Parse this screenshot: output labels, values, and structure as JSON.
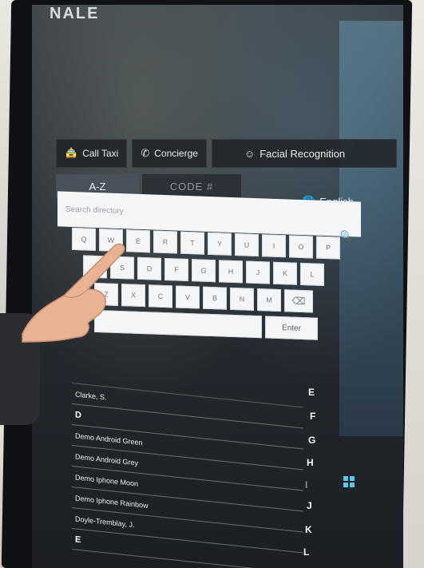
{
  "screen": {
    "brand": "NALE"
  },
  "actions": [
    {
      "label": "Call Taxi",
      "icon": "taxi-icon"
    },
    {
      "label": "Concierge",
      "icon": "phone-icon"
    },
    {
      "label": "Facial Recognition",
      "icon": "face-icon"
    }
  ],
  "tabs": [
    {
      "label": "A-Z",
      "active": true
    },
    {
      "label": "CODE #",
      "active": false
    }
  ],
  "language": {
    "label": "English",
    "icon": "globe-icon"
  },
  "search": {
    "placeholder": "Search directory",
    "icon": "search-icon"
  },
  "keyboard": {
    "row1": [
      "Q",
      "W",
      "E",
      "R",
      "T",
      "Y",
      "U",
      "I",
      "O",
      "P"
    ],
    "row2": [
      "A",
      "S",
      "D",
      "F",
      "G",
      "H",
      "J",
      "K",
      "L"
    ],
    "row3": [
      "Z",
      "X",
      "C",
      "V",
      "B",
      "N",
      "M"
    ],
    "backspace": "⌫",
    "enter": "Enter"
  },
  "directory": {
    "rows": [
      {
        "type": "entry",
        "text": ""
      },
      {
        "type": "entry",
        "text": "Clarke, S."
      },
      {
        "type": "head",
        "text": "D"
      },
      {
        "type": "entry",
        "text": "Demo Android Green"
      },
      {
        "type": "entry",
        "text": "Demo Android Grey"
      },
      {
        "type": "entry",
        "text": "Demo Iphone Moon"
      },
      {
        "type": "entry",
        "text": "Demo Iphone Rainbow"
      },
      {
        "type": "entry",
        "text": "Doyle-Tremblay, J."
      },
      {
        "type": "head",
        "text": "E"
      }
    ]
  },
  "alphabet": [
    "E",
    "F",
    "G",
    "H",
    "I",
    "J",
    "K",
    "L"
  ],
  "colors": {
    "accent": "#5cc6e6",
    "screen_bg": "#2a2f36",
    "key_bg": "#f3f5f7"
  }
}
